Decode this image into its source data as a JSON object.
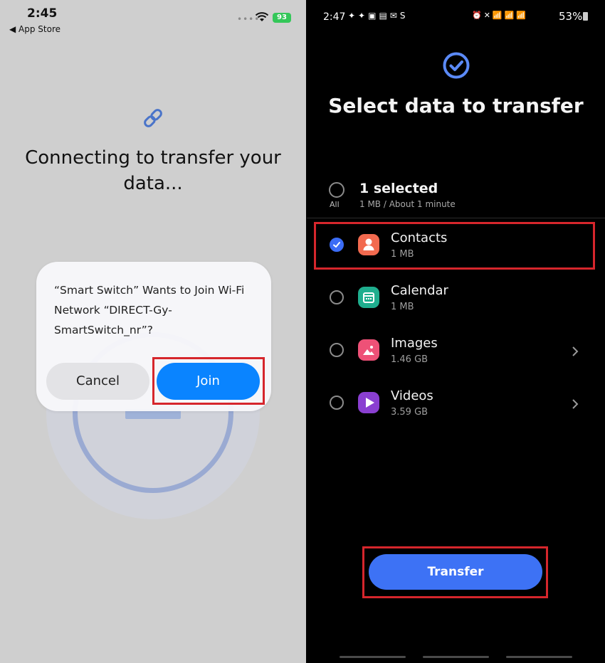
{
  "ios": {
    "status": {
      "time": "2:45",
      "back": "◀ App Store",
      "battery": "93"
    },
    "heading": "Connecting to transfer your data...",
    "dialog": {
      "message": "“Smart Switch” Wants to Join Wi-Fi Network “DIRECT-Gy-SmartSwitch_nr”?",
      "cancel_label": "Cancel",
      "join_label": "Join"
    }
  },
  "android": {
    "status": {
      "time": "2:47",
      "battery": "53%"
    },
    "title": "Select data to transfer",
    "all_label": "All",
    "selected_count": "1 selected",
    "selected_size": "1 MB / About 1 minute",
    "items": [
      {
        "name": "Contacts",
        "size": "1 MB",
        "checked": true,
        "icon": "contacts-icon",
        "color": "#f26a4f"
      },
      {
        "name": "Calendar",
        "size": "1 MB",
        "checked": false,
        "icon": "calendar-icon",
        "color": "#1fae8e"
      },
      {
        "name": "Images",
        "size": "1.46 GB",
        "checked": false,
        "icon": "images-icon",
        "color": "#ee5177"
      },
      {
        "name": "Videos",
        "size": "3.59 GB",
        "checked": false,
        "icon": "videos-icon",
        "color": "#8a3fd1"
      }
    ],
    "transfer_label": "Transfer"
  },
  "colors": {
    "ios_accent": "#0a84ff",
    "android_accent": "#3d72f5",
    "highlight": "#d6262c"
  }
}
